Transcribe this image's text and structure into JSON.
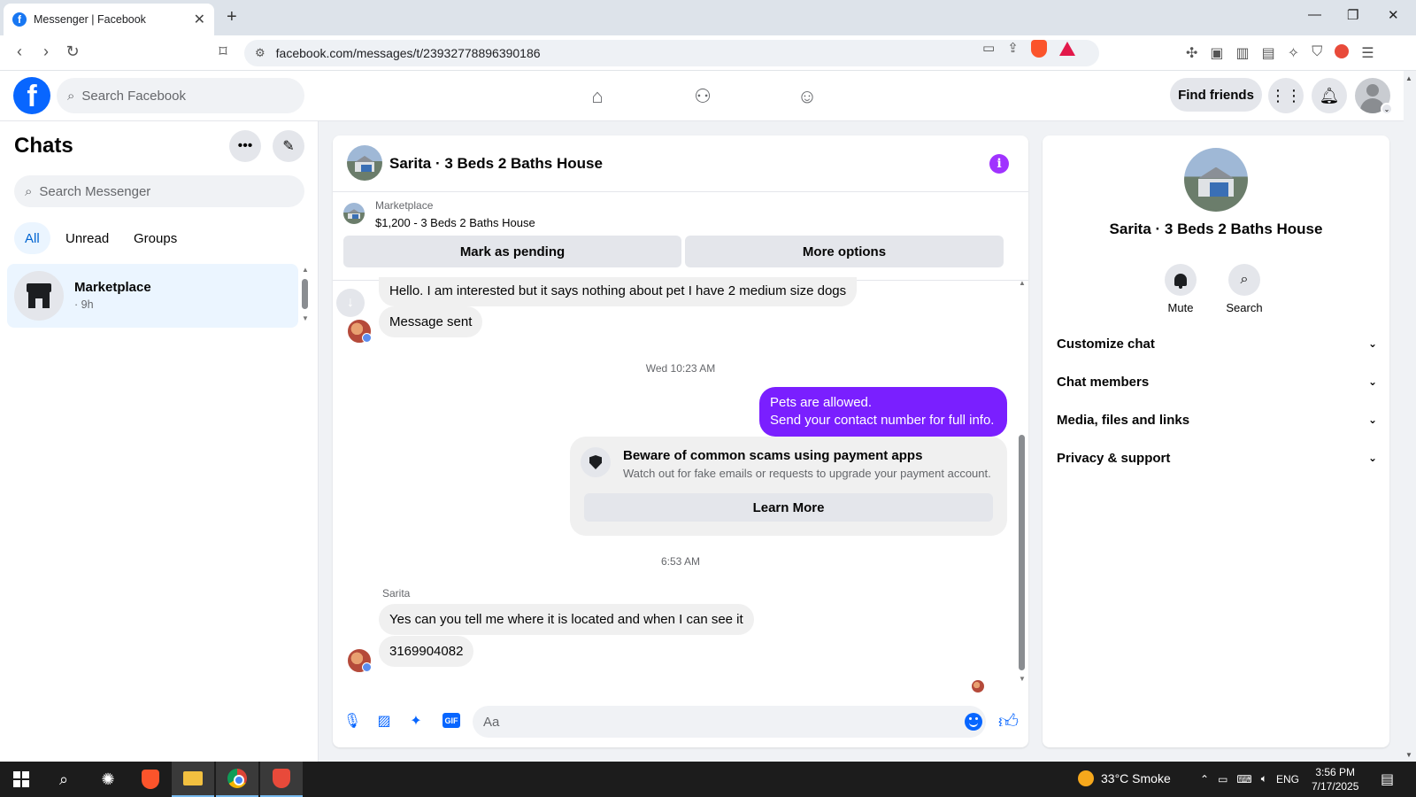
{
  "browser": {
    "tab_title": "Messenger | Facebook",
    "url": "facebook.com/messages/t/23932778896390186"
  },
  "fb_header": {
    "logo_letter": "f",
    "search_placeholder": "Search Facebook",
    "find_friends_label": "Find friends"
  },
  "chats_panel": {
    "title": "Chats",
    "search_placeholder": "Search Messenger",
    "filters": [
      "All",
      "Unread",
      "Groups"
    ],
    "active_filter": "All",
    "items": [
      {
        "name": "Marketplace",
        "time": "· 9h"
      }
    ]
  },
  "conversation": {
    "title": "Sarita · 3 Beds 2 Baths House",
    "marketplace_label": "Marketplace",
    "listing": "$1,200 - 3 Beds 2 Baths House",
    "mark_pending_label": "Mark as pending",
    "more_options_label": "More options",
    "messages": {
      "m1": "Hello. I am interested but it says nothing about pet I have 2 medium size dogs",
      "m2": "Message sent",
      "ts1": "Wed 10:23 AM",
      "out_line1": "Pets are allowed.",
      "out_line2": "Send your contact number for full info.",
      "scam_title": "Beware of common scams using payment apps",
      "scam_text": "Watch out for fake emails or requests to upgrade your payment account.",
      "learn_more": "Learn More",
      "ts2": "6:53 AM",
      "sender": "Sarita",
      "m3": "Yes can you tell me where it is located and when I can see it",
      "m4": "3169904082"
    },
    "composer_placeholder": "Aa"
  },
  "info_panel": {
    "name": "Sarita · 3 Beds 2 Baths House",
    "actions": [
      "Mute",
      "Search"
    ],
    "sections": [
      "Customize chat",
      "Chat members",
      "Media, files and links",
      "Privacy & support"
    ]
  },
  "taskbar": {
    "weather": "33°C  Smoke",
    "language": "ENG",
    "time": "3:56 PM",
    "date": "7/17/2025"
  },
  "colors": {
    "brand_blue": "#0866ff",
    "outgoing_bubble": "#7a1fff",
    "info_icon": "#a033ff",
    "active_filter_bg": "#ebf5ff"
  }
}
